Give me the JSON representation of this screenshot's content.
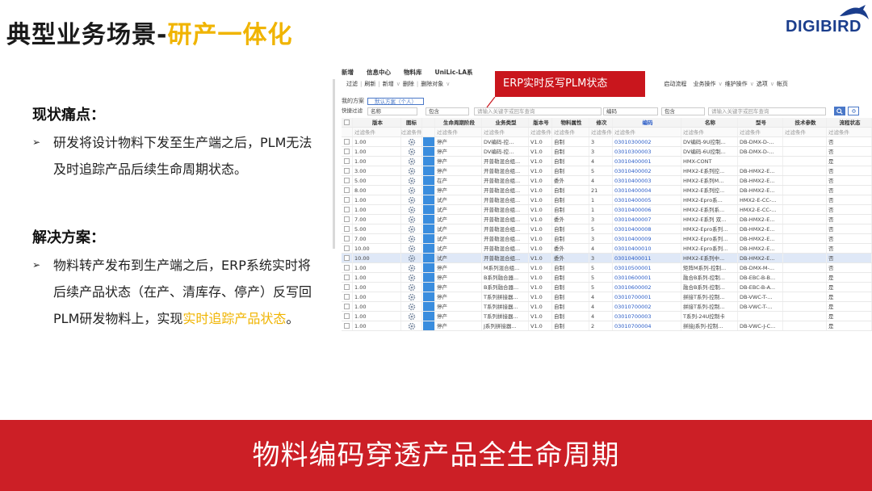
{
  "slide": {
    "title_main": "典型业务场景-",
    "title_highlight": "研产一体化",
    "logo_text": "DIGIBIRD",
    "pain_heading": "现状痛点：",
    "pain_text": "研发将设计物料下发至生产端之后，PLM无法及时追踪产品后续生命周期状态。",
    "solution_heading": "解决方案：",
    "solution_text_a": "物料转产发布到生产端之后，ERP系统实时将后续产品状态（在产、清库存、停产）反写回PLM研发物料上，实现",
    "solution_text_highlight": "实时追踪产品状态",
    "solution_text_end": "。",
    "footer": "物料编码穿透产品全生命周期",
    "colors": {
      "accent_yellow": "#f0b400",
      "brand_red": "#cc1f26",
      "logo_blue": "#1a3d8c"
    }
  },
  "shot": {
    "menu": [
      "新增",
      "信息中心",
      "物料库",
      "UniLic-LA系"
    ],
    "toolbar": [
      "过滤",
      "刷新",
      "新增",
      "删除",
      "删除对象",
      "启动流程",
      "业务操作",
      "维护操作",
      "选项",
      "帐页"
    ],
    "banner": "ERP实时反写PLM状态",
    "plan_label": "我的方案",
    "plan_value": "默认方案（个人）",
    "filter_label": "快捷过滤",
    "filter1_field": "名称",
    "filter1_op": "包含",
    "filter1_placeholder": "请输入关键字或回车查询",
    "filter2_field": "编码",
    "filter2_op": "包含",
    "filter2_placeholder": "请输入关键字或回车查询",
    "search_icon": "search-icon",
    "headers": [
      "版本",
      "图标",
      "生命周期阶段",
      "业务类型",
      "版本号",
      "物料属性",
      "修次",
      "编码",
      "名称",
      "型号",
      "技术参数",
      "流程状态"
    ],
    "subheader": "过滤条件",
    "rows": [
      {
        "ver": "1.00",
        "stage": "停产",
        "type": "DV编码-控...",
        "vno": "V1.0",
        "attr": "自制",
        "rev": "3",
        "code": "03010300002",
        "name": "DV编码-9U控制...",
        "model": "DB-DMX-D-...",
        "flow": "否"
      },
      {
        "ver": "1.00",
        "stage": "停产",
        "type": "DV编码-控...",
        "vno": "V1.0",
        "attr": "自制",
        "rev": "3",
        "code": "03010300003",
        "name": "DV编码-6U控制...",
        "model": "DB-DMX-D-...",
        "flow": "否"
      },
      {
        "ver": "1.00",
        "stage": "停产",
        "type": "开普勒混合组...",
        "vno": "V1.0",
        "attr": "自制",
        "rev": "4",
        "code": "03010400001",
        "name": "HMX-CONT",
        "model": "",
        "flow": "是"
      },
      {
        "ver": "3.00",
        "stage": "停产",
        "type": "开普勒混合组...",
        "vno": "V1.0",
        "attr": "自制",
        "rev": "5",
        "code": "03010400002",
        "name": "HMX2-E系列控...",
        "model": "DB-HMX2-E...",
        "flow": "否"
      },
      {
        "ver": "5.00",
        "stage": "在产",
        "type": "开普勒混合组...",
        "vno": "V1.0",
        "attr": "委外",
        "rev": "4",
        "code": "03010400003",
        "name": "HMX2-E系列M...",
        "model": "DB-HMX2-E...",
        "flow": "否"
      },
      {
        "ver": "8.00",
        "stage": "停产",
        "type": "开普勒混合组...",
        "vno": "V1.0",
        "attr": "自制",
        "rev": "21",
        "code": "03010400004",
        "name": "HMX2-E系列控...",
        "model": "DB-HMX2-E...",
        "flow": "否"
      },
      {
        "ver": "1.00",
        "stage": "试产",
        "type": "开普勒混合组...",
        "vno": "V1.0",
        "attr": "自制",
        "rev": "1",
        "code": "03010400005",
        "name": "HMX2-Epro系...",
        "model": "HMX2-E-CC-...",
        "flow": "否"
      },
      {
        "ver": "1.00",
        "stage": "试产",
        "type": "开普勒混合组...",
        "vno": "V1.0",
        "attr": "自制",
        "rev": "1",
        "code": "03010400006",
        "name": "HMX2-E系列系...",
        "model": "HMX2-E-CC-...",
        "flow": "否"
      },
      {
        "ver": "7.00",
        "stage": "试产",
        "type": "开普勒混合组...",
        "vno": "V1.0",
        "attr": "委外",
        "rev": "3",
        "code": "03010400007",
        "name": "HMX2-E系列 双...",
        "model": "DB-HMX2-E...",
        "flow": "否"
      },
      {
        "ver": "5.00",
        "stage": "试产",
        "type": "开普勒混合组...",
        "vno": "V1.0",
        "attr": "自制",
        "rev": "5",
        "code": "03010400008",
        "name": "HMX2-Epro系列...",
        "model": "DB-HMX2-E...",
        "flow": "否"
      },
      {
        "ver": "7.00",
        "stage": "试产",
        "type": "开普勒混合组...",
        "vno": "V1.0",
        "attr": "自制",
        "rev": "3",
        "code": "03010400009",
        "name": "HMX2-Epro系列...",
        "model": "DB-HMX2-E...",
        "flow": "否"
      },
      {
        "ver": "10.00",
        "stage": "试产",
        "type": "开普勒混合组...",
        "vno": "V1.0",
        "attr": "委外",
        "rev": "4",
        "code": "03010400010",
        "name": "HMX2-Epro系列...",
        "model": "DB-HMX2-E...",
        "flow": "否"
      },
      {
        "ver": "10.00",
        "stage": "试产",
        "type": "开普勒混合组...",
        "vno": "V1.0",
        "attr": "委外",
        "rev": "3",
        "code": "03010400011",
        "name": "HMX2-E系列中...",
        "model": "DB-HMX2-E...",
        "flow": "否"
      },
      {
        "ver": "1.00",
        "stage": "停产",
        "type": "M系列混合组...",
        "vno": "V1.0",
        "attr": "自制",
        "rev": "5",
        "code": "03010500001",
        "name": "矩阵M系列-控制...",
        "model": "DB-DMX-M-...",
        "flow": "否"
      },
      {
        "ver": "1.00",
        "stage": "停产",
        "type": "B系列融合器...",
        "vno": "V1.0",
        "attr": "自制",
        "rev": "5",
        "code": "03010600001",
        "name": "融合B系列-控制...",
        "model": "DB-EBC-B-B...",
        "flow": "是"
      },
      {
        "ver": "1.00",
        "stage": "停产",
        "type": "B系列融合器...",
        "vno": "V1.0",
        "attr": "自制",
        "rev": "5",
        "code": "03010600002",
        "name": "融合B系列-控制...",
        "model": "DB-EBC-B-A...",
        "flow": "是"
      },
      {
        "ver": "1.00",
        "stage": "停产",
        "type": "T系列拼接器...",
        "vno": "V1.0",
        "attr": "自制",
        "rev": "4",
        "code": "03010700001",
        "name": "拼接T系列-控制...",
        "model": "DB-VWC-T-...",
        "flow": "是"
      },
      {
        "ver": "1.00",
        "stage": "停产",
        "type": "T系列拼接器...",
        "vno": "V1.0",
        "attr": "自制",
        "rev": "4",
        "code": "03010700002",
        "name": "拼接T系列-控制...",
        "model": "DB-VWC-T-...",
        "flow": "是"
      },
      {
        "ver": "1.00",
        "stage": "停产",
        "type": "T系列拼接器...",
        "vno": "V1.0",
        "attr": "自制",
        "rev": "4",
        "code": "03010700003",
        "name": "T系列-24U控制卡",
        "model": "",
        "flow": "是"
      },
      {
        "ver": "1.00",
        "stage": "停产",
        "type": "J系列拼接器...",
        "vno": "V1.0",
        "attr": "自制",
        "rev": "2",
        "code": "03010700004",
        "name": "拼接J系列-控制...",
        "model": "DB-VWC-J-C...",
        "flow": "是"
      }
    ],
    "selected_row": 12
  }
}
